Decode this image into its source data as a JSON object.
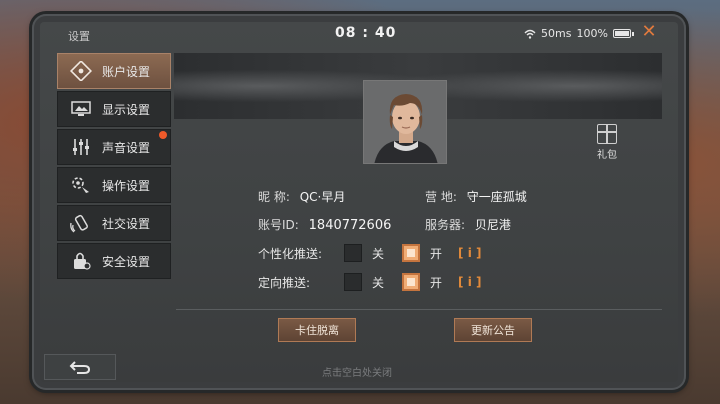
{
  "status_bar": {
    "title": "设置",
    "time": "08 : 40",
    "ping": "50ms",
    "battery": "100%"
  },
  "sidebar": {
    "items": [
      {
        "label": "账户设置",
        "icon": "account-icon",
        "active": true
      },
      {
        "label": "显示设置",
        "icon": "display-icon",
        "active": false
      },
      {
        "label": "声音设置",
        "icon": "sound-icon",
        "active": false,
        "badge": true
      },
      {
        "label": "操作设置",
        "icon": "control-icon",
        "active": false
      },
      {
        "label": "社交设置",
        "icon": "social-icon",
        "active": false
      },
      {
        "label": "安全设置",
        "icon": "security-icon",
        "active": false
      }
    ]
  },
  "gift": {
    "label": "礼包"
  },
  "profile": {
    "nickname_label": "昵    称:",
    "nickname": "QC·早月",
    "camp_label": "营    地:",
    "camp": "守一座孤城",
    "id_label": "账号ID:",
    "id": "1840772606",
    "server_label": "服务器:",
    "server": "贝尼港"
  },
  "toggles": [
    {
      "label": "个性化推送:",
      "off_label": "关",
      "on_label": "开",
      "state": "on"
    },
    {
      "label": "定向推送:",
      "off_label": "关",
      "on_label": "开",
      "state": "on"
    }
  ],
  "buttons": {
    "unstuck": "卡住脱离",
    "announcement": "更新公告"
  },
  "hint": "点击空白处关闭",
  "colors": {
    "accent": "#e38a3a",
    "active_tab": "#8c6a52",
    "close": "#e07a3e"
  }
}
